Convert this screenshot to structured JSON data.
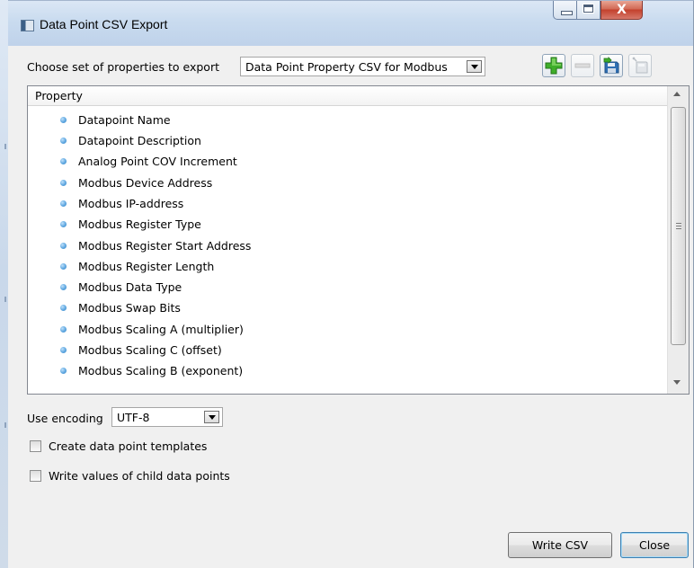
{
  "window": {
    "title": "Data Point CSV Export",
    "close_glyph": "X"
  },
  "export": {
    "choose_label": "Choose set of properties to export",
    "selected_set": "Data Point Property CSV for Modbus"
  },
  "toolbar": {
    "icons": [
      "add-icon",
      "remove-icon",
      "save-icon",
      "rename-icon"
    ]
  },
  "list": {
    "header": "Property",
    "items": [
      "Datapoint Name",
      "Datapoint Description",
      "Analog Point COV Increment",
      "Modbus Device Address",
      "Modbus IP-address",
      "Modbus Register Type",
      "Modbus Register Start Address",
      "Modbus Register Length",
      "Modbus Data Type",
      "Modbus Swap Bits",
      "Modbus Scaling A (multiplier)",
      "Modbus Scaling C (offset)",
      "Modbus Scaling B (exponent)"
    ]
  },
  "encoding": {
    "label": "Use encoding",
    "value": "UTF-8"
  },
  "options": {
    "create_templates": {
      "label": "Create data point templates",
      "checked": false
    },
    "write_child_values": {
      "label": "Write values of child data points",
      "checked": false
    }
  },
  "buttons": {
    "write_csv": "Write CSV",
    "close": "Close"
  },
  "colors": {
    "add_green": "#3fae2a",
    "accent_blue": "#3c7fb1",
    "title_bar": "#c9dbef"
  }
}
